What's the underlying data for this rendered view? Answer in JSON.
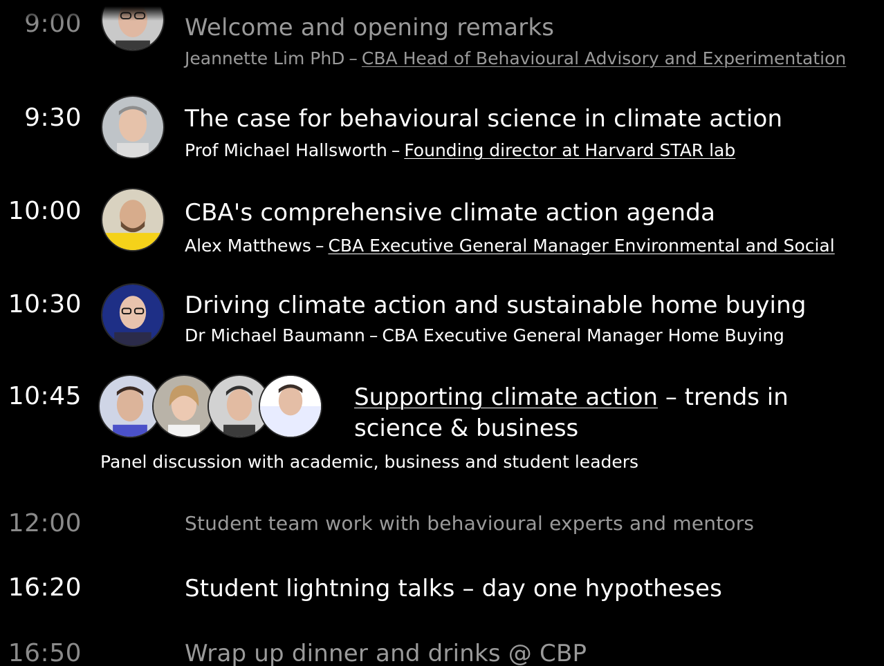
{
  "schedule": [
    {
      "time": "9:00",
      "title": "Welcome and opening remarks",
      "speaker_name": "Jeannette Lim PhD",
      "speaker_role": "CBA Head of Behavioural Advisory and Experimentation",
      "state": "faded"
    },
    {
      "time": "9:30",
      "title": "The case for behavioural science in climate action",
      "speaker_name": "Prof Michael Hallsworth",
      "speaker_role": "Founding director at Harvard STAR lab",
      "state": "normal"
    },
    {
      "time": "10:00",
      "title": "CBA's comprehensive climate action agenda",
      "speaker_name": "Alex Matthews",
      "speaker_role": "CBA Executive General Manager Environmental and Social",
      "state": "normal"
    },
    {
      "time": "10:30",
      "title": "Driving climate action and sustainable home buying",
      "speaker_name": "Dr Michael Baumann",
      "speaker_role": "CBA Executive General Manager Home Buying",
      "state": "normal"
    },
    {
      "time": "10:45",
      "title_underlined": "Supporting climate action",
      "title_rest": " – trends in science & business",
      "sub": "Panel discussion with academic, business and student leaders",
      "state": "normal"
    },
    {
      "time": "12:00",
      "title": "Student team work with behavioural experts and mentors",
      "state": "faded"
    },
    {
      "time": "16:20",
      "title": "Student lightning talks – day one hypotheses",
      "state": "normal"
    },
    {
      "time": "16:50",
      "title": "Wrap up dinner and drinks @ CBP",
      "state": "faded"
    }
  ],
  "separator": "–",
  "colors": {
    "background": "#000000",
    "text": "#ffffff",
    "dim_text": "#9a9a9a"
  }
}
